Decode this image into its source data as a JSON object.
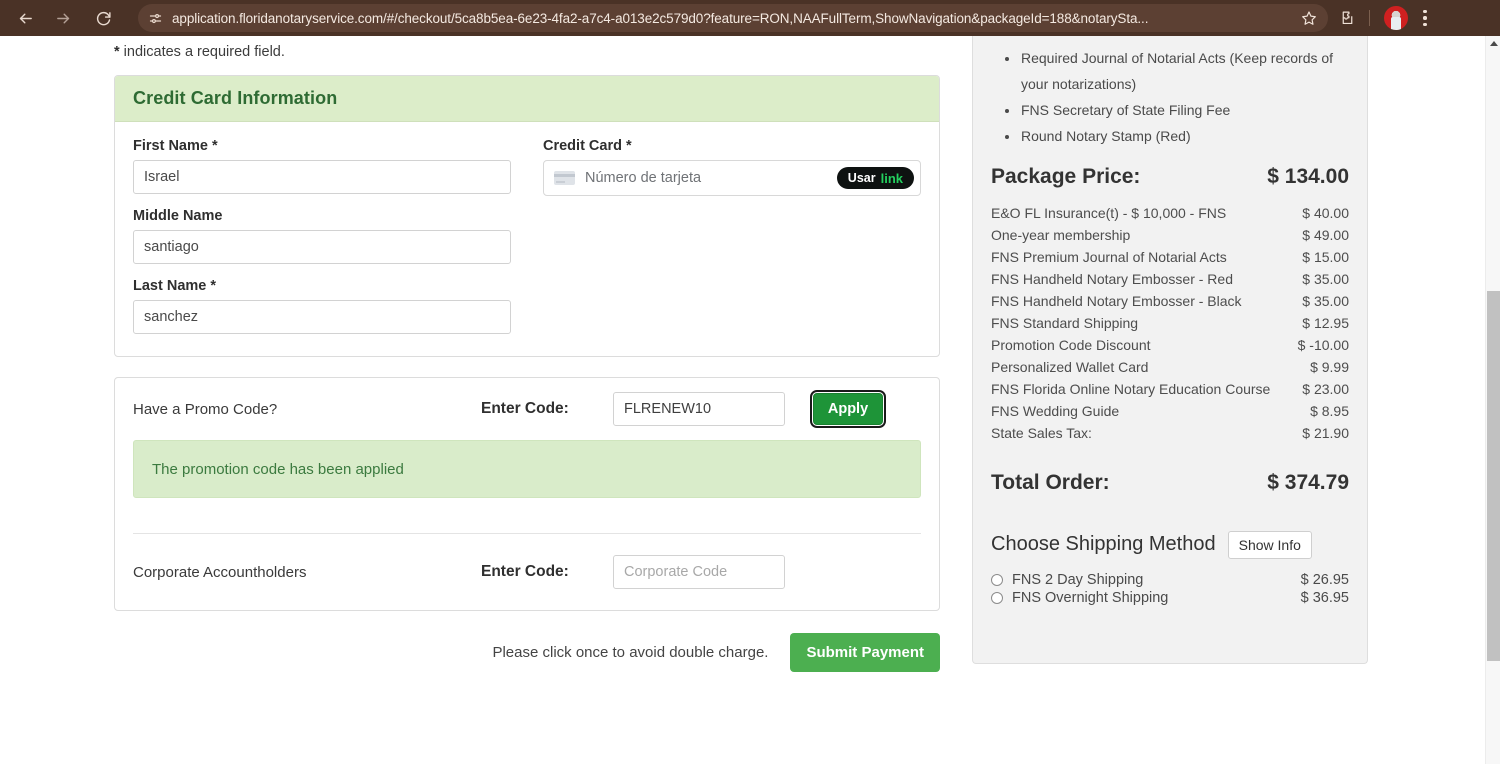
{
  "browser": {
    "url": "application.floridanotaryservice.com/#/checkout/5ca8b5ea-6e23-4fa2-a7c4-a013e2c579d0?feature=RON,NAAFullTerm,ShowNavigation&packageId=188&notarySta...",
    "back_icon": "back-arrow-icon",
    "forward_icon": "forward-arrow-icon",
    "reload_icon": "reload-icon",
    "site_info_icon": "site-settings-icon",
    "bookmark_icon": "star-icon",
    "extensions_icon": "puzzle-icon",
    "profile_icon": "profile-avatar",
    "menu_icon": "kebab-menu-icon"
  },
  "main": {
    "required_note_star": "*",
    "required_note": " indicates a required field.",
    "credit_card_section": {
      "title": "Credit Card Information",
      "fields": {
        "first_name_label": "First Name ",
        "first_name_star": "*",
        "first_name_value": "Israel",
        "middle_name_label": "Middle Name",
        "middle_name_value": "santiago",
        "last_name_label": "Last Name ",
        "last_name_star": "*",
        "last_name_value": "sanchez",
        "credit_card_label": "Credit Card ",
        "credit_card_star": "*",
        "credit_card_placeholder": "Número de tarjeta",
        "link_button_prefix": "Usar",
        "link_button_brand": "link"
      }
    },
    "promo_section": {
      "promo_label": "Have a Promo Code?",
      "enter_code_label": "Enter Code:",
      "promo_value": "FLRENEW10",
      "apply_label": "Apply",
      "alert_message": "The promotion code has been applied",
      "corporate_label": "Corporate Accountholders",
      "corporate_enter_code_label": "Enter Code:",
      "corporate_placeholder": "Corporate Code"
    },
    "submit": {
      "note": "Please click once to avoid double charge.",
      "button_label": "Submit Payment"
    }
  },
  "sidebar": {
    "features": [
      "Required Journal of Notarial Acts (Keep records of your notarizations)",
      "FNS Secretary of State Filing Fee",
      "Round Notary Stamp (Red)"
    ],
    "package_price_label": "Package Price:",
    "package_price_value": "$ 134.00",
    "line_items": [
      {
        "name": "E&O FL Insurance(t) - $ 10,000 - FNS",
        "amount": "$ 40.00"
      },
      {
        "name": "One-year membership",
        "amount": "$ 49.00"
      },
      {
        "name": "FNS Premium Journal of Notarial Acts",
        "amount": "$ 15.00"
      },
      {
        "name": "FNS Handheld Notary Embosser - Red",
        "amount": "$ 35.00"
      },
      {
        "name": "FNS Handheld Notary Embosser - Black",
        "amount": "$ 35.00"
      },
      {
        "name": "FNS Standard Shipping",
        "amount": "$ 12.95"
      },
      {
        "name": "Promotion Code Discount",
        "amount": "$ -10.00"
      },
      {
        "name": "Personalized Wallet Card",
        "amount": "$ 9.99"
      },
      {
        "name": "FNS Florida Online Notary Education Course",
        "amount": "$ 23.00"
      },
      {
        "name": "FNS Wedding Guide",
        "amount": "$ 8.95"
      },
      {
        "name": "State Sales Tax:",
        "amount": "$ 21.90"
      }
    ],
    "total_label": "Total Order:",
    "total_value": "$ 374.79",
    "shipping_title": "Choose Shipping Method",
    "show_info_label": "Show Info",
    "shipping_options": [
      {
        "name": "FNS 2 Day Shipping",
        "amount": "$ 26.95",
        "selected": false
      },
      {
        "name": "FNS Overnight Shipping",
        "amount": "$ 36.95",
        "selected": false
      }
    ]
  },
  "colors": {
    "brand_green": "#2e6b33",
    "header_green_bg": "#dcedc9",
    "apply_green": "#1e9438",
    "submit_green": "#4caf50",
    "link_brand_green": "#23d05e",
    "chrome_brown": "#4a3226"
  }
}
